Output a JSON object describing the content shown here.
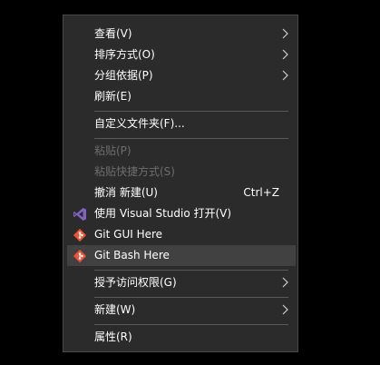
{
  "menu": {
    "items": [
      {
        "label": "查看(V)"
      },
      {
        "label": "排序方式(O)"
      },
      {
        "label": "分组依据(P)"
      },
      {
        "label": "刷新(E)"
      },
      {
        "label": "自定义文件夹(F)..."
      },
      {
        "label": "粘贴(P)"
      },
      {
        "label": "粘贴快捷方式(S)"
      },
      {
        "label": "撤消 新建(U)",
        "shortcut": "Ctrl+Z"
      },
      {
        "label": "使用 Visual Studio 打开(V)"
      },
      {
        "label": "Git GUI Here"
      },
      {
        "label": "Git Bash Here"
      },
      {
        "label": "授予访问权限(G)"
      },
      {
        "label": "新建(W)"
      },
      {
        "label": "属性(R)"
      }
    ]
  },
  "colors": {
    "menu_bg": "#2b2b2b",
    "hover_bg": "#414141",
    "text": "#ffffff",
    "disabled_text": "#6d6d6d",
    "vs_purple": "#8661c5",
    "git_orange": "#f05133"
  },
  "icons": {
    "submenu": "chevron-right-icon",
    "visual_studio": "visual-studio-icon",
    "git": "git-icon"
  }
}
